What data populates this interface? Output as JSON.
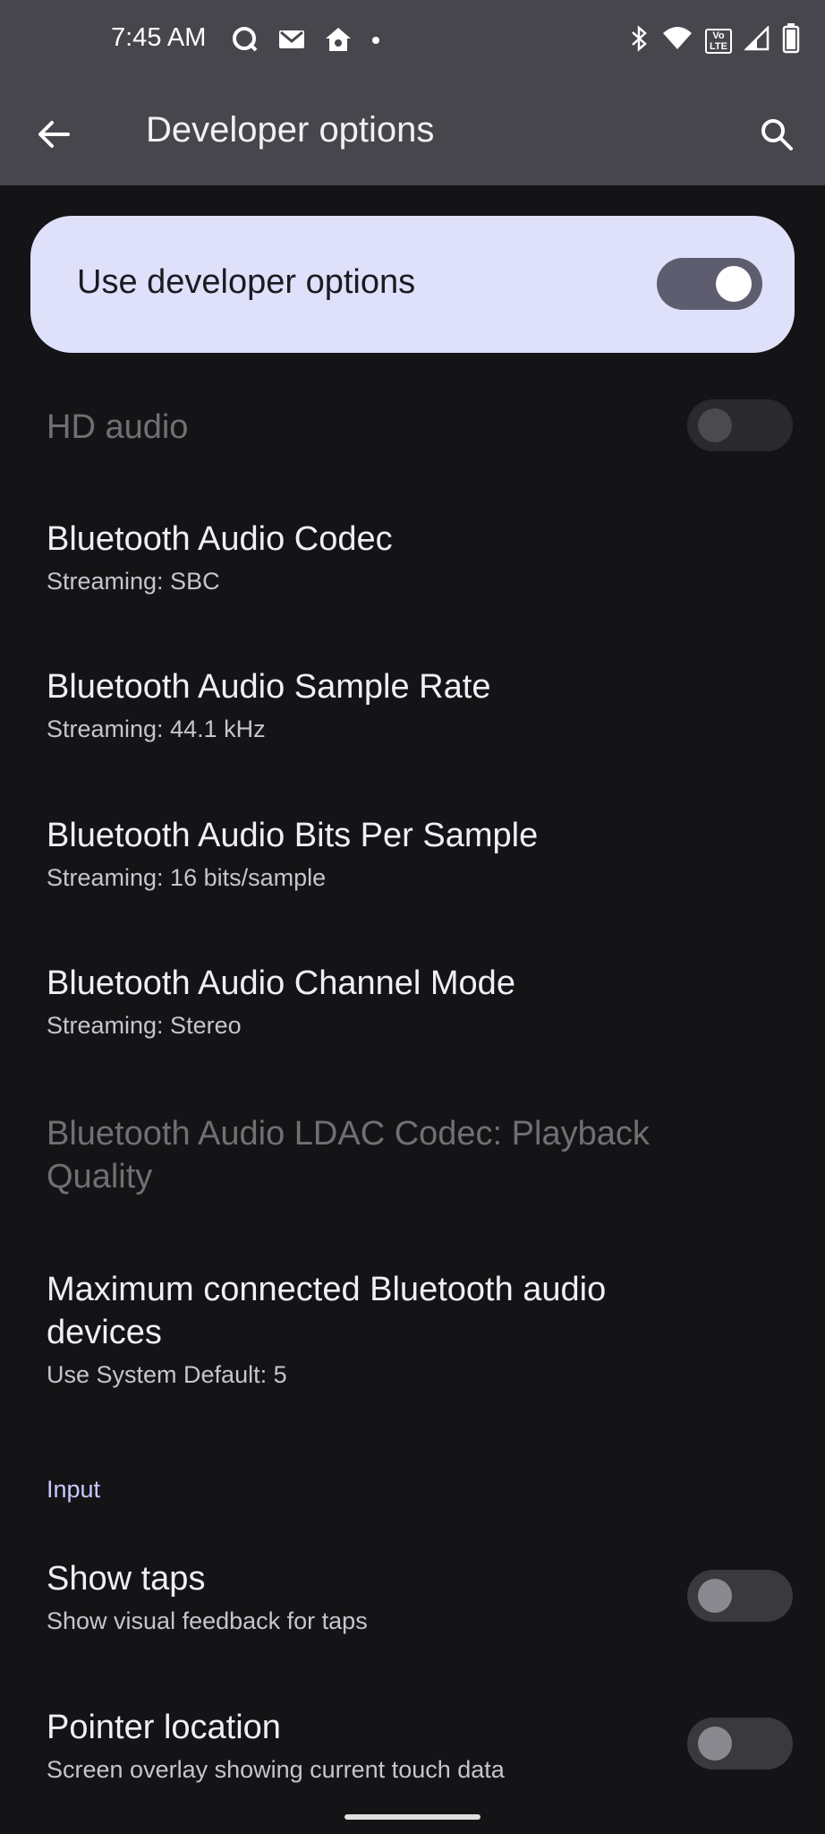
{
  "status": {
    "time": "7:45 AM",
    "volte": "Vo",
    "lte": "LTE"
  },
  "appbar": {
    "title": "Developer options"
  },
  "master": {
    "label": "Use developer options",
    "enabled": true
  },
  "items": [
    {
      "title": "HD audio",
      "subtitle": "",
      "disabled": true,
      "toggle": "off"
    },
    {
      "title": "Bluetooth Audio Codec",
      "subtitle": "Streaming: SBC"
    },
    {
      "title": "Bluetooth Audio Sample Rate",
      "subtitle": "Streaming: 44.1 kHz"
    },
    {
      "title": "Bluetooth Audio Bits Per Sample",
      "subtitle": "Streaming: 16 bits/sample"
    },
    {
      "title": "Bluetooth Audio Channel Mode",
      "subtitle": "Streaming: Stereo"
    },
    {
      "title": "Bluetooth Audio LDAC Codec: Playback Quality",
      "subtitle": "",
      "disabled": true
    },
    {
      "title": "Maximum connected Bluetooth audio devices",
      "subtitle": "Use System Default: 5"
    }
  ],
  "section_input": "Input",
  "input_items": [
    {
      "title": "Show taps",
      "subtitle": "Show visual feedback for taps",
      "toggle": "off"
    },
    {
      "title": "Pointer location",
      "subtitle": "Screen overlay showing current touch data",
      "toggle": "off"
    }
  ],
  "colors": {
    "appbar": "#47464c",
    "background": "#141416",
    "card": "#dfe0fa",
    "accent": "#cac8ff"
  }
}
